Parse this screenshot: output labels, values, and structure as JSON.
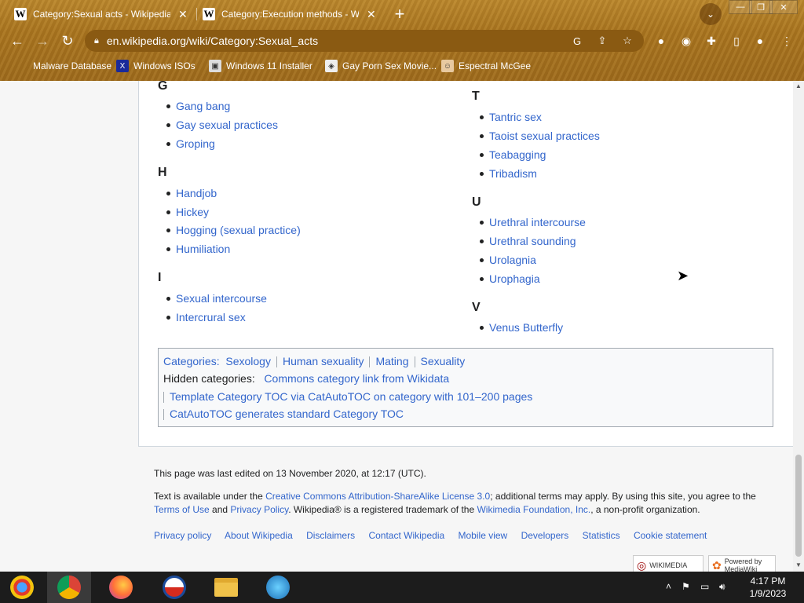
{
  "browser": {
    "tabs": [
      {
        "title": "Category:Sexual acts - Wikipedia"
      },
      {
        "title": "Category:Execution methods - Wi"
      }
    ],
    "url": "en.wikipedia.org/wiki/Category:Sexual_acts",
    "bookmarks": [
      {
        "label": "Malware Database"
      },
      {
        "label": "Windows ISOs"
      },
      {
        "label": "Windows 11 Installer"
      },
      {
        "label": "Gay Porn Sex Movie..."
      },
      {
        "label": "Espectral McGee"
      }
    ]
  },
  "article": {
    "left_groups": [
      {
        "letter": "G",
        "items": [
          "Gang bang",
          "Gay sexual practices",
          "Groping"
        ]
      },
      {
        "letter": "H",
        "items": [
          "Handjob",
          "Hickey",
          "Hogging (sexual practice)",
          "Humiliation"
        ]
      },
      {
        "letter": "I",
        "items": [
          "Sexual intercourse",
          "Intercrural sex"
        ]
      }
    ],
    "right_groups": [
      {
        "letter": "T",
        "items": [
          "Tantric sex",
          "Taoist sexual practices",
          "Teabagging",
          "Tribadism"
        ]
      },
      {
        "letter": "U",
        "items": [
          "Urethral intercourse",
          "Urethral sounding",
          "Urolagnia",
          "Urophagia"
        ]
      },
      {
        "letter": "V",
        "items": [
          "Venus Butterfly"
        ]
      }
    ]
  },
  "categories": {
    "label": "Categories:",
    "items": [
      "Sexology",
      "Human sexuality",
      "Mating",
      "Sexuality"
    ],
    "hidden_label": "Hidden categories:",
    "hidden_items": [
      "Commons category link from Wikidata",
      "Template Category TOC via CatAutoTOC on category with 101–200 pages",
      "CatAutoTOC generates standard Category TOC"
    ]
  },
  "footer": {
    "last_edited": "This page was last edited on 13 November 2020, at 12:17 (UTC).",
    "license_pre": "Text is available under the ",
    "license_link": "Creative Commons Attribution-ShareAlike License 3.0",
    "license_mid": "; additional terms may apply. By using this site, you agree to the",
    "terms_link": "Terms of Use",
    "and": " and ",
    "privacy_link": "Privacy Policy",
    "trademark_pre": ". Wikipedia® is a registered trademark of the ",
    "foundation_link": "Wikimedia Foundation, Inc.",
    "trademark_post": ", a non-profit organization.",
    "links": [
      "Privacy policy",
      "About Wikipedia",
      "Disclaimers",
      "Contact Wikipedia",
      "Mobile view",
      "Developers",
      "Statistics",
      "Cookie statement"
    ],
    "badge1": "WIKIMEDIA",
    "badge2_top": "Powered by",
    "badge2_bottom": "MediaWiki"
  },
  "taskbar": {
    "time": "4:17 PM",
    "date": "1/9/2023"
  }
}
